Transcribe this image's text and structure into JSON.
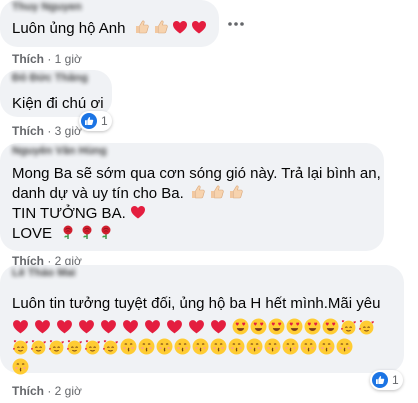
{
  "comments": [
    {
      "author": "Thuy Nguyen",
      "text": "Luôn ủng hộ Anh",
      "emojis": [
        "thumbs-up",
        "thumbs-up",
        "red-heart",
        "red-heart"
      ],
      "like_label": "Thích",
      "time": "1 giờ"
    },
    {
      "author": "Đỗ Đức Thắng",
      "text": "Kiện đi chú ơi",
      "like_label": "Thích",
      "time": "3 giờ",
      "reaction_count": "1"
    },
    {
      "author": "Nguyễn Văn Hùng",
      "lines": [
        "Mong Ba sẽ sớm qua cơn sóng gió này. Trả lại bình an,",
        "danh dự và uy tín cho Ba.",
        "TIN TƯỞNG BA.",
        "LOVE"
      ],
      "like_label": "Thích",
      "time": "2 giờ"
    },
    {
      "author": "Lê Thảo Mai",
      "text": "Luôn tin tưởng tuyệt đối, ủng hộ ba H hết mình.Mãi yêu",
      "like_label": "Thích",
      "time": "2 giờ",
      "reaction_count": "1"
    }
  ],
  "colors": {
    "bubble": "#f0f2f5",
    "heart": "#e0245e",
    "like_blue": "#1b74e4",
    "meta_gray": "#65676b"
  }
}
